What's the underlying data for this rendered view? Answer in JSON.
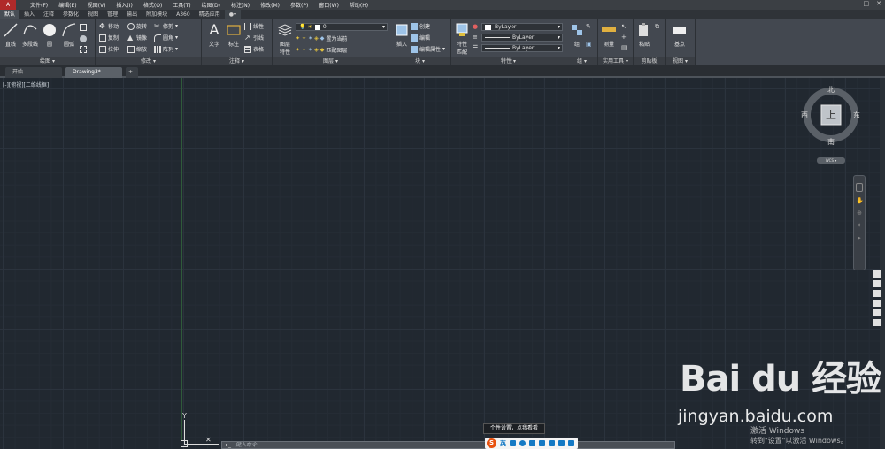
{
  "menubar": {
    "logo": "A",
    "items": [
      "文件(F)",
      "编辑(E)",
      "视图(V)",
      "插入(I)",
      "格式(O)",
      "工具(T)",
      "绘图(D)",
      "标注(N)",
      "修改(M)",
      "参数(P)",
      "窗口(W)",
      "帮助(H)"
    ],
    "controls": [
      "—",
      "□",
      "✕"
    ]
  },
  "ribbon_tabs": [
    "默认",
    "插入",
    "注释",
    "参数化",
    "视图",
    "管理",
    "输出",
    "附加模块",
    "A360",
    "精选应用"
  ],
  "active_ribbon_tab": "默认",
  "ribbon": {
    "draw": {
      "title": "绘图 ▾",
      "line": "直线",
      "polyline": "多段线",
      "circle": "圆",
      "arc": "圆弧"
    },
    "modify": {
      "title": "修改 ▾",
      "move": "移动",
      "rotate": "旋转",
      "trim": "修剪",
      "copy": "复制",
      "mirror": "镜像",
      "fillet": "圆角",
      "stretch": "拉伸",
      "scale": "缩放",
      "array": "阵列"
    },
    "annotation": {
      "title": "注释 ▾",
      "text": "文字",
      "dimension": "标注",
      "linear": "线性",
      "leader": "引线",
      "table": "表格"
    },
    "layers": {
      "title": "图层 ▾",
      "layer_props_1": "图层",
      "layer_props_2": "特性",
      "layer_value": "0",
      "make_current": "置为当前",
      "match_layer": "匹配图层"
    },
    "block": {
      "title": "块 ▾",
      "insert": "插入",
      "create": "创建",
      "edit": "编辑",
      "edit_attr": "编辑属性"
    },
    "properties": {
      "title": "特性 ▾",
      "match_1": "特性",
      "match_2": "匹配",
      "color": "ByLayer",
      "linetype": "ByLayer",
      "lineweight": "ByLayer"
    },
    "groups": {
      "title": "组 ▾",
      "group": "组"
    },
    "utilities": {
      "title": "实用工具 ▾",
      "measure": "测量"
    },
    "clipboard": {
      "title": "剪贴板",
      "paste": "粘贴"
    },
    "view": {
      "title": "视图 ▾",
      "base": "基点"
    }
  },
  "doc_tabs": [
    {
      "label": "开始"
    },
    {
      "label": "Drawing3*"
    },
    {
      "label": "+"
    }
  ],
  "viewport_label": "[-][俯视][二维线框]",
  "viewcube": {
    "north": "北",
    "south": "南",
    "east": "东",
    "west": "西",
    "face": "上",
    "wcs": "WCS ▾"
  },
  "ucs": {
    "y_label": "Y",
    "x_label": "X"
  },
  "command_line": {
    "placeholder": "键入命令"
  },
  "ime": {
    "tooltip": "个性设置，点我看看",
    "lang": "英",
    "logo": "S"
  },
  "watermark": {
    "brand": "Bai du 经验",
    "url": "jingyan.baidu.com",
    "activate_1": "激活 Windows",
    "activate_2": "转到\"设置\"以激活 Windows。"
  },
  "colors": {
    "canvas": "#212830",
    "ribbon": "#434850",
    "menubar": "#3b3f44",
    "accent_ime": "#e8500c"
  }
}
